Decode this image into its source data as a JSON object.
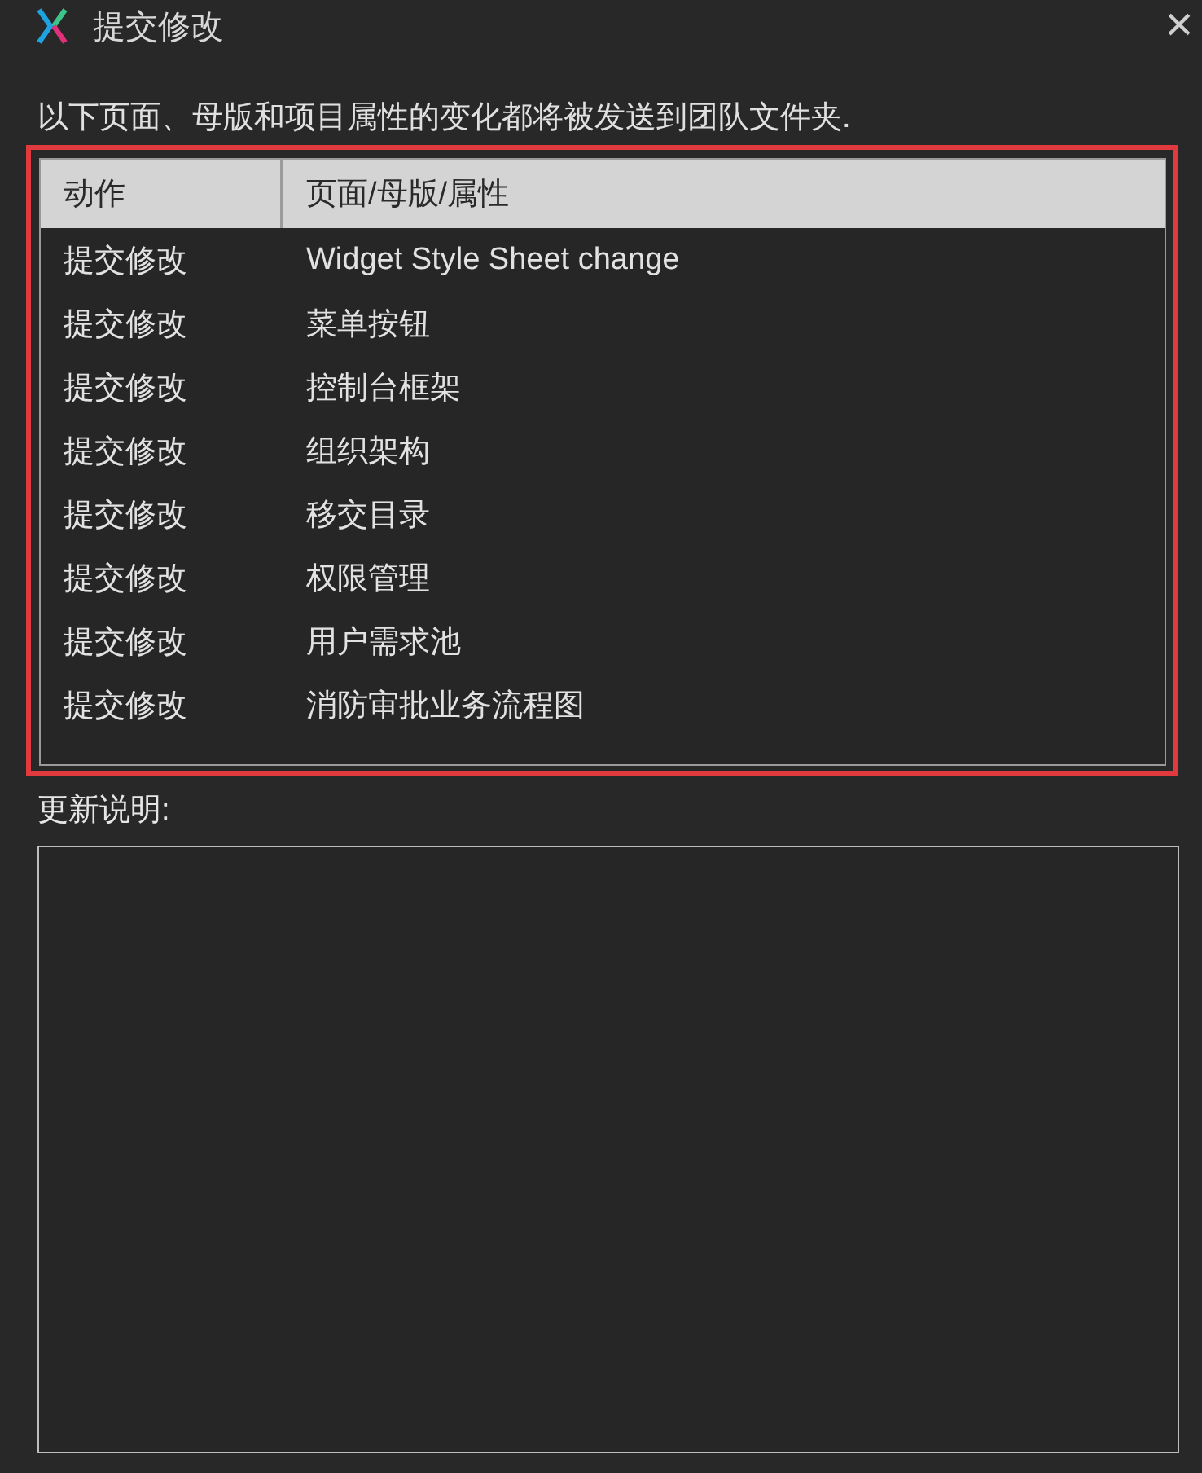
{
  "window": {
    "title": "提交修改",
    "close": "×"
  },
  "description": "以下页面、母版和项目属性的变化都将被发送到团队文件夹.",
  "table": {
    "columns": [
      "动作",
      "页面/母版/属性"
    ],
    "rows": [
      {
        "action": "提交修改",
        "item": "Widget Style Sheet change"
      },
      {
        "action": "提交修改",
        "item": "菜单按钮"
      },
      {
        "action": "提交修改",
        "item": "控制台框架"
      },
      {
        "action": "提交修改",
        "item": "组织架构"
      },
      {
        "action": "提交修改",
        "item": "移交目录"
      },
      {
        "action": "提交修改",
        "item": "权限管理"
      },
      {
        "action": "提交修改",
        "item": "用户需求池"
      },
      {
        "action": "提交修改",
        "item": "消防审批业务流程图"
      }
    ]
  },
  "notes": {
    "label": "更新说明:"
  }
}
